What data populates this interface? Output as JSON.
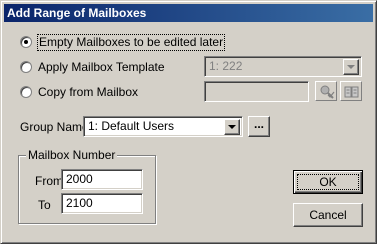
{
  "window": {
    "title": "Add Range of Mailboxes"
  },
  "options": {
    "empty": {
      "label": "Empty Mailboxes to be edited later",
      "selected": true
    },
    "template": {
      "label": "Apply Mailbox Template",
      "selected": false,
      "combo_value": "1: 222"
    },
    "copy": {
      "label": "Copy from Mailbox",
      "selected": false,
      "field_value": "",
      "search_icon": "find-mailbox-icon",
      "directory_icon": "address-book-icon"
    }
  },
  "group": {
    "label": "Group Name",
    "value": "1: Default Users",
    "browse_label": "..."
  },
  "mailbox_number": {
    "caption": "Mailbox Number",
    "from_label": "From",
    "from_value": "2000",
    "to_label": "To",
    "to_value": "2100"
  },
  "buttons": {
    "ok": "OK",
    "cancel": "Cancel"
  },
  "colors": {
    "titlebar_start": "#0a246a",
    "titlebar_end": "#3a6ea5",
    "face": "#d4d0c8"
  }
}
